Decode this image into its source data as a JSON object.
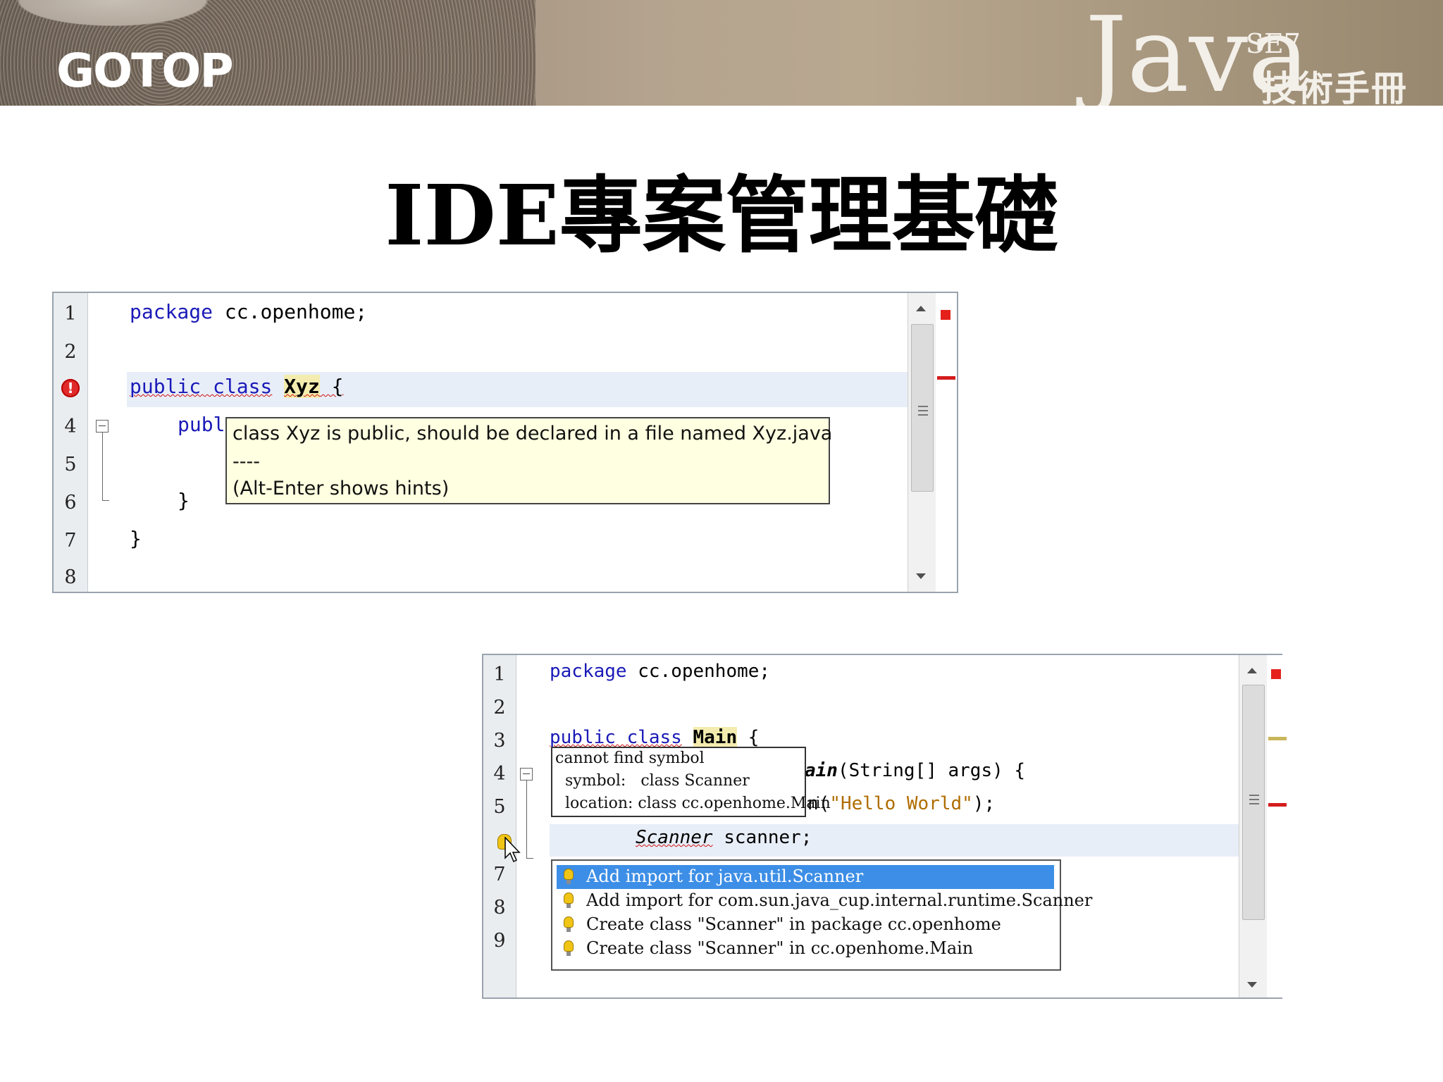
{
  "header": {
    "publisher_logo": "GOTOP",
    "book_title": "Java",
    "book_edition": "SE7",
    "book_subtitle": "技術手冊"
  },
  "slide_title": "IDE專案管理基礎",
  "editor1": {
    "line_numbers": [
      "1",
      "2",
      "3",
      "4",
      "5",
      "6",
      "7",
      "8"
    ],
    "lines": {
      "l1_kw": "package",
      "l1_rest": " cc.openhome;",
      "l3_kw": "public class",
      "l3_name": "Xyz",
      "l3_rest": " {",
      "l4_kw": "publ",
      "l6": "}",
      "l7": "}"
    },
    "tooltip": {
      "line1": "class Xyz is public, should be declared in a file named Xyz.java",
      "line2": "----",
      "line3": "(Alt-Enter shows hints)"
    }
  },
  "editor2": {
    "line_numbers": [
      "1",
      "2",
      "3",
      "4",
      "5",
      "",
      "7",
      "8",
      "9"
    ],
    "lines": {
      "l1_kw": "package",
      "l1_rest": " cc.openhome;",
      "l3_kw": "public class",
      "l3_name": "Main",
      "l3_rest": " {",
      "l4_tail": "ain",
      "l4_rest": "(String[] args) {",
      "l5_pre": "n(",
      "l5_str": "\"Hello World\"",
      "l5_post": ");",
      "l6_type": "Scanner",
      "l6_rest": " scanner;"
    },
    "tooltip": {
      "line1": "cannot find symbol",
      "line2": "  symbol:   class Scanner",
      "line3": "  location: class cc.openhome.Main"
    },
    "hints": [
      {
        "label": "Add import for java.util.Scanner",
        "selected": true
      },
      {
        "label": "Add import for com.sun.java_cup.internal.runtime.Scanner",
        "selected": false
      },
      {
        "label": "Create class \"Scanner\" in package cc.openhome",
        "selected": false
      },
      {
        "label": "Create class \"Scanner\" in cc.openhome.Main",
        "selected": false
      }
    ]
  }
}
